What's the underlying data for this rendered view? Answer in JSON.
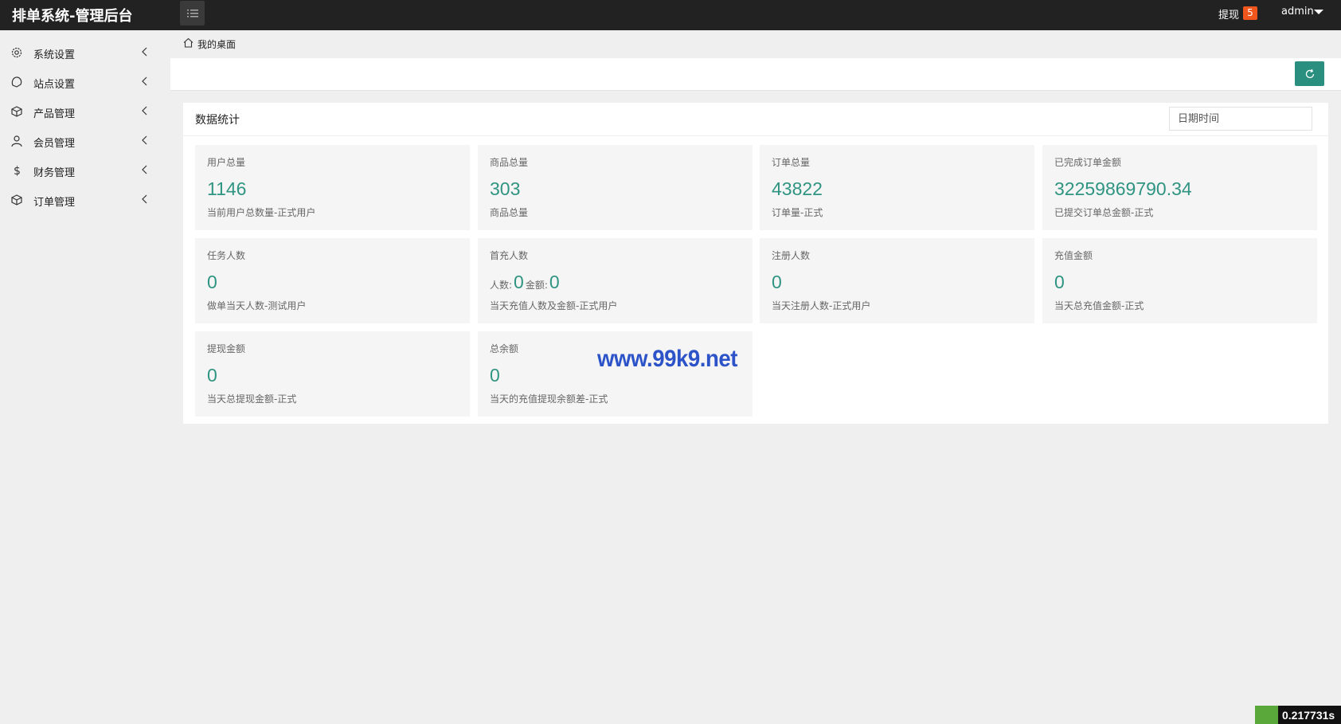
{
  "app": {
    "title": "排单系统-管理后台"
  },
  "header": {
    "withdraw_label": "提现",
    "withdraw_badge": "5",
    "user_name": "admin"
  },
  "sidebar": {
    "items": [
      {
        "label": "系统设置",
        "icon": "gear-icon"
      },
      {
        "label": "站点设置",
        "icon": "shape-icon"
      },
      {
        "label": "产品管理",
        "icon": "box-icon"
      },
      {
        "label": "会员管理",
        "icon": "user-icon"
      },
      {
        "label": "财务管理",
        "icon": "dollar-icon"
      },
      {
        "label": "订单管理",
        "icon": "box-icon"
      }
    ]
  },
  "breadcrumb": {
    "label": "我的桌面"
  },
  "stats": {
    "title": "数据统计",
    "date_placeholder": "日期时间",
    "cards": [
      {
        "label": "用户总量",
        "value": "1146",
        "desc": "当前用户总数量-正式用户"
      },
      {
        "label": "商品总量",
        "value": "303",
        "desc": "商品总量"
      },
      {
        "label": "订单总量",
        "value": "43822",
        "desc": "订单量-正式"
      },
      {
        "label": "已完成订单金额",
        "value": "32259869790.34",
        "desc": "已提交订单总金额-正式"
      },
      {
        "label": "任务人数",
        "value": "0",
        "desc": "做单当天人数-测试用户"
      },
      {
        "label": "首充人数",
        "count_label": "人数:",
        "count_value": "0",
        "amount_label": "金额:",
        "amount_value": "0",
        "desc": "当天充值人数及金额-正式用户"
      },
      {
        "label": "注册人数",
        "value": "0",
        "desc": "当天注册人数-正式用户"
      },
      {
        "label": "充值金额",
        "value": "0",
        "desc": "当天总充值金额-正式"
      },
      {
        "label": "提现金额",
        "value": "0",
        "desc": "当天总提现金额-正式"
      },
      {
        "label": "总余额",
        "value": "0",
        "desc": "当天的充值提现余额差-正式"
      }
    ]
  },
  "watermark": "www.99k9.net",
  "timer": "0.217731s",
  "colors": {
    "accent": "#2a8f7e",
    "value_text": "#2f9481",
    "topbar": "#222222",
    "badge": "#f2561d"
  }
}
